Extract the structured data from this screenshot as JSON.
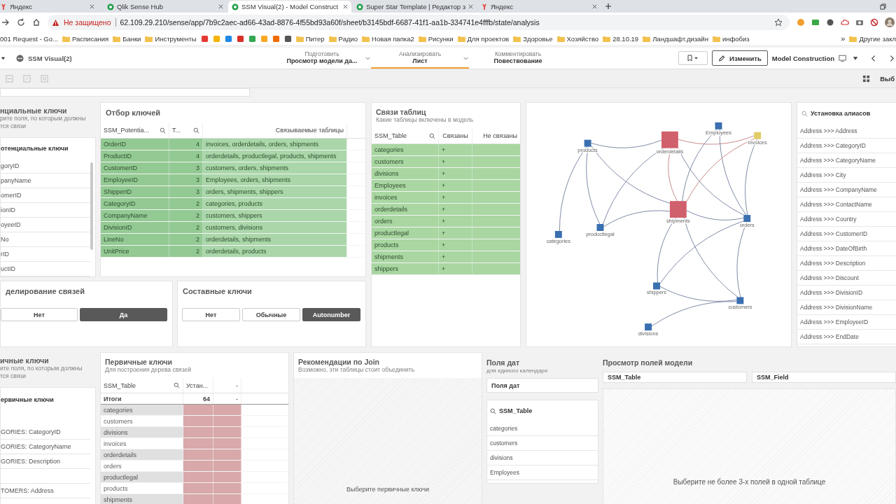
{
  "browser": {
    "tabs": [
      {
        "title": "Яндекс",
        "kind": "yandex",
        "selected": false
      },
      {
        "title": "Qlik Sense Hub",
        "kind": "qlik",
        "selected": false
      },
      {
        "title": "SSM Visual(2) - Model Construct",
        "kind": "qlik",
        "selected": true
      },
      {
        "title": "Super Star Template | Редактор з",
        "kind": "qlik",
        "selected": false
      },
      {
        "title": "Яндекс",
        "kind": "yandex",
        "selected": false
      }
    ],
    "security": "Не защищено",
    "url": "62.109.29.210/sense/app/7b9c2aec-ad66-43ad-8876-4f55bd93a60f/sheet/b3145bdf-6687-41f1-aa1b-334741e4fffb/state/analysis",
    "bookmarks": [
      {
        "kind": "page",
        "label": "001 Request - Go..."
      },
      {
        "kind": "folder",
        "label": "Расписания"
      },
      {
        "kind": "folder",
        "label": "Банки"
      },
      {
        "kind": "folder",
        "label": "Инструменты"
      },
      {
        "kind": "app",
        "color": "#e53935"
      },
      {
        "kind": "app",
        "color": "#f4b400"
      },
      {
        "kind": "app",
        "color": "#1e88e5"
      },
      {
        "kind": "app",
        "color": "#d93025"
      },
      {
        "kind": "app",
        "color": "#34a853"
      },
      {
        "kind": "app",
        "color": "#f9a825"
      },
      {
        "kind": "app",
        "color": "#ef6c00"
      },
      {
        "kind": "app",
        "color": "#555555"
      },
      {
        "kind": "folder",
        "label": "Питер"
      },
      {
        "kind": "folder",
        "label": "Радио"
      },
      {
        "kind": "folder",
        "label": "Новая папка2"
      },
      {
        "kind": "folder",
        "label": "Рисунки"
      },
      {
        "kind": "folder",
        "label": "Для проектов"
      },
      {
        "kind": "folder",
        "label": "Здоровье"
      },
      {
        "kind": "folder",
        "label": "Хозяйство"
      },
      {
        "kind": "folder",
        "label": "28.10.19"
      },
      {
        "kind": "folder",
        "label": "Ландшафт.дизайн"
      },
      {
        "kind": "folder",
        "label": "инфобиз"
      }
    ],
    "overflow": "»",
    "other_bookmarks": "Другие закл"
  },
  "app": {
    "title": "SSM Visual(2)",
    "steps": [
      {
        "label": "Подготовить",
        "value": "Просмотр модели да...",
        "selected": false
      },
      {
        "label": "Анализировать",
        "value": "Лист",
        "selected": true
      },
      {
        "label": "Комментировать",
        "value": "Повествование",
        "selected": false
      }
    ],
    "edit": "Изменить",
    "sheet": "Model Construction",
    "selections": "Выб"
  },
  "potential_keys": {
    "title": "нциальные ключи",
    "subtitle_lines": [
      "рите поля, по которым должны",
      "тся связи"
    ],
    "list_title": "отенциальные ключи",
    "items": [
      "goryID",
      "panyName",
      "omerID",
      "ionID",
      "oyeeID",
      "No",
      "rID",
      "uctID"
    ]
  },
  "key_selection": {
    "title": "Отбор ключей",
    "columns": [
      "SSM_Potentia...",
      "T...",
      "Связываемые таблицы"
    ],
    "rows": [
      [
        "OrderID",
        "4",
        "invoices, orderdetails, orders, shipments"
      ],
      [
        "ProductID",
        "4",
        "orderdetails, productlegal, products, shipments"
      ],
      [
        "CustomerID",
        "3",
        "customers, orders, shipments"
      ],
      [
        "EmployeeID",
        "3",
        "Employees, orders, shipments"
      ],
      [
        "ShipperID",
        "3",
        "orders, shipments, shippers"
      ],
      [
        "CategoryID",
        "2",
        "categories, products"
      ],
      [
        "CompanyName",
        "2",
        "customers, shippers"
      ],
      [
        "DivisionID",
        "2",
        "customers, divisions"
      ],
      [
        "LineNo",
        "2",
        "orderdetails, shipments"
      ],
      [
        "UnitPrice",
        "2",
        "orderdetails, products"
      ]
    ]
  },
  "link_modeling": {
    "title": "делирование связей",
    "options": [
      {
        "label": "Нет",
        "selected": false
      },
      {
        "label": "Да",
        "selected": true
      }
    ]
  },
  "composite_keys": {
    "title": "Составные ключи",
    "options": [
      {
        "label": "Нет",
        "selected": false
      },
      {
        "label": "Обычные",
        "selected": false
      },
      {
        "label": "Autonumber",
        "selected": true
      }
    ]
  },
  "table_links": {
    "title": "Связи таблиц",
    "subtitle": "Какие таблицы включены в модель",
    "columns": [
      "SSM_Table",
      "Связаны",
      "Не связаны"
    ],
    "rows": [
      [
        "categories",
        "+"
      ],
      [
        "customers",
        "+"
      ],
      [
        "divisions",
        "+"
      ],
      [
        "Employees",
        "+"
      ],
      [
        "invoices",
        "+"
      ],
      [
        "orderdetails",
        "+"
      ],
      [
        "orders",
        "+"
      ],
      [
        "productlegal",
        "+"
      ],
      [
        "products",
        "+"
      ],
      [
        "shipments",
        "+"
      ],
      [
        "shippers",
        "+"
      ]
    ]
  },
  "graph": {
    "nodes": [
      {
        "label": "products",
        "kind": "small",
        "color": "#3a6fb0"
      },
      {
        "label": "orderdetails",
        "kind": "large",
        "color": "#d0606c"
      },
      {
        "label": "Employees",
        "kind": "small",
        "color": "#3a6fb0"
      },
      {
        "label": "invoices",
        "kind": "small",
        "color": "#e0cc66"
      },
      {
        "label": "categories",
        "kind": "small",
        "color": "#3a6fb0"
      },
      {
        "label": "productlegal",
        "kind": "small",
        "color": "#3a6fb0"
      },
      {
        "label": "shipments",
        "kind": "large",
        "color": "#d0606c"
      },
      {
        "label": "orders",
        "kind": "small",
        "color": "#3a6fb0"
      },
      {
        "label": "shippers",
        "kind": "small",
        "color": "#3a6fb0"
      },
      {
        "label": "customers",
        "kind": "small",
        "color": "#3a6fb0"
      },
      {
        "label": "divisions",
        "kind": "small",
        "color": "#3a6fb0"
      }
    ]
  },
  "aliases": {
    "title": "Установка алиасов",
    "items": [
      "Address >>> Address",
      "Address >>> CategoryID",
      "Address >>> CategoryName",
      "Address >>> City",
      "Address >>> CompanyName",
      "Address >>> ContactName",
      "Address >>> Country",
      "Address >>> CustomerID",
      "Address >>> DateOfBirth",
      "Address >>> Description",
      "Address >>> Discount",
      "Address >>> DivisionID",
      "Address >>> DivisionName",
      "Address >>> EmployeeID",
      "Address >>> EndDate"
    ]
  },
  "primary_left": {
    "title": "ичные ключи",
    "subtitle_lines": [
      "ите поля, по которым должны",
      "тся связи"
    ],
    "list_title": "ервичные ключи",
    "items": [
      {
        "kind": "field",
        "text": "GORIES: CategoryID"
      },
      {
        "kind": "field",
        "text": "GORIES: CategoryName"
      },
      {
        "kind": "field",
        "text": "GORIES: Description"
      },
      {
        "kind": "spacer"
      },
      {
        "kind": "field",
        "text": "TOMERS: Address"
      }
    ]
  },
  "primary_keys": {
    "title": "Первичные ключи",
    "subtitle": "Для построения дерева связей",
    "columns": [
      "SSM_Table",
      "Устан...",
      "-"
    ],
    "totals": [
      "Итоги",
      "64",
      "-"
    ],
    "rows": [
      "categories",
      "customers",
      "divisions",
      "invoices",
      "orderdetails",
      "orders",
      "productlegal",
      "products",
      "shipments"
    ]
  },
  "join": {
    "title": "Рекомендации по Join",
    "subtitle": "Возможно, эти таблицы стоит объединить",
    "message": "Выберите первичные ключи"
  },
  "date_fields": {
    "title": "Поля дат",
    "subtitle": "для единого календаря",
    "field": "Поля дат",
    "list_title": "SSM_Table",
    "items": [
      "categories",
      "customers",
      "divisions",
      "Employees"
    ]
  },
  "model_fields": {
    "title": "Просмотр полей модели",
    "filters": [
      "SSM_Table",
      "SSM_Field"
    ],
    "message": "Выберите не более 3-х полей в одной таблице"
  }
}
